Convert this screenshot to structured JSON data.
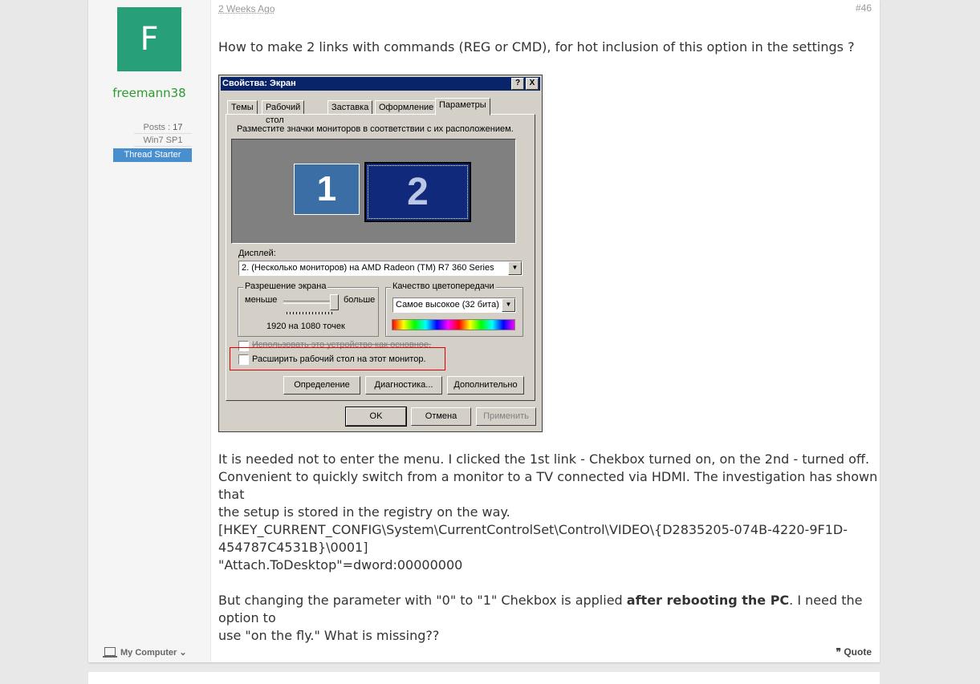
{
  "user": {
    "avatar_letter": "F",
    "name": "freemann38",
    "posts_label": "Posts :",
    "posts_value": "17",
    "os": "Win7 SP1",
    "badge": "Thread Starter",
    "my_computer": "My Computer"
  },
  "post": {
    "date": "2 Weeks Ago",
    "number": "#46",
    "question": "How to make 2 links with commands (REG or CMD), for hot inclusion of this option in the settings ?",
    "para1_l1": "It is needed not to enter the menu. I clicked the 1st link - Chekbox turned on, on the 2nd - turned off.",
    "para1_l2": "Convenient to quickly switch from a monitor to a TV connected via HDMI. The investigation has shown that",
    "para1_l3": "the setup is stored in the registry on the way.",
    "reg_l1": "[HKEY_CURRENT_CONFIG\\System\\CurrentControlSet\\Control\\VIDEO\\{D2835205-074B-4220-9F1D-",
    "reg_l2": "454787C4531B}\\0001]",
    "reg_l3": "\"Attach.ToDesktop\"=dword:00000000",
    "para3_pre": "But changing the parameter with \"0\" to \"1\" Chekbox is applied ",
    "para3_bold": "after rebooting the PC",
    "para3_post": ". I need the option to",
    "para3_l2": "use \"on the fly.\" What is missing??",
    "quote": "Quote"
  },
  "dialog": {
    "title": "Свойства: Экран",
    "help_btn": "?",
    "close_btn": "X",
    "tabs": [
      "Темы",
      "Рабочий стол",
      "Заставка",
      "Оформление",
      "Параметры"
    ],
    "instruction": "Разместите значки мониторов в соответствии с их расположением.",
    "monitor1": "1",
    "monitor2": "2",
    "display_label": "Дисплей:",
    "display_value": "2. (Несколько мониторов) на AMD Radeon (TM) R7 360 Series",
    "resolution_group": "Разрешение экрана",
    "less": "меньше",
    "more": "больше",
    "resolution_value": "1920 на 1080 точек",
    "color_group": "Качество цветопередачи",
    "color_value": "Самое высокое (32 бита)",
    "primary_check": "Использовать это устройство как основное.",
    "extend_check": "Расширить рабочий стол на этот монитор.",
    "identify_btn": "Определение",
    "diag_btn": "Диагностика...",
    "advanced_btn": "Дополнительно",
    "ok_btn": "OK",
    "cancel_btn": "Отмена",
    "apply_btn": "Применить"
  },
  "colors": {
    "avatar_bg": "#27a07a",
    "username": "#2e9b2e",
    "badge_bg": "#4a8fcd",
    "win_titlebar": "#0a246a",
    "highlight_box": "#e00000"
  }
}
